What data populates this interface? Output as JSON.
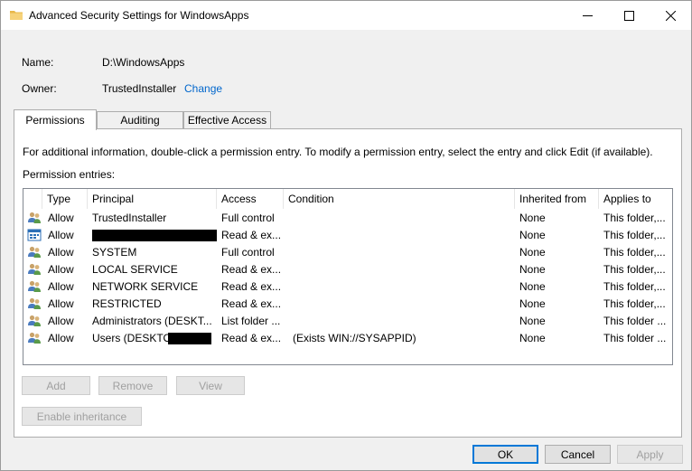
{
  "window": {
    "title": "Advanced Security Settings for WindowsApps"
  },
  "info": {
    "name_label": "Name:",
    "name_value": "D:\\WindowsApps",
    "owner_label": "Owner:",
    "owner_value": "TrustedInstaller",
    "change_link": "Change"
  },
  "tabs": [
    {
      "label": "Permissions",
      "active": true
    },
    {
      "label": "Auditing",
      "active": false
    },
    {
      "label": "Effective Access",
      "active": false
    }
  ],
  "panel": {
    "instructions": "For additional information, double-click a permission entry. To modify a permission entry, select the entry and click Edit (if available).",
    "entries_label": "Permission entries:"
  },
  "table": {
    "headers": [
      "Type",
      "Principal",
      "Access",
      "Condition",
      "Inherited from",
      "Applies to"
    ],
    "rows": [
      {
        "icon": "users-icon",
        "type": "Allow",
        "principal": "TrustedInstaller",
        "access": "Full control",
        "condition": "",
        "inherited": "None",
        "applies": "This folder,..."
      },
      {
        "icon": "app-package-icon",
        "type": "Allow",
        "principal": "",
        "access": "Read & ex...",
        "condition": "",
        "inherited": "None",
        "applies": "This folder,..."
      },
      {
        "icon": "users-icon",
        "type": "Allow",
        "principal": "SYSTEM",
        "access": "Full control",
        "condition": "",
        "inherited": "None",
        "applies": "This folder,..."
      },
      {
        "icon": "users-icon",
        "type": "Allow",
        "principal": "LOCAL SERVICE",
        "access": "Read & ex...",
        "condition": "",
        "inherited": "None",
        "applies": "This folder,..."
      },
      {
        "icon": "users-icon",
        "type": "Allow",
        "principal": "NETWORK SERVICE",
        "access": "Read & ex...",
        "condition": "",
        "inherited": "None",
        "applies": "This folder,..."
      },
      {
        "icon": "users-icon",
        "type": "Allow",
        "principal": "RESTRICTED",
        "access": "Read & ex...",
        "condition": "",
        "inherited": "None",
        "applies": "This folder,..."
      },
      {
        "icon": "users-icon",
        "type": "Allow",
        "principal": "Administrators (DESKT...",
        "access": "List folder ...",
        "condition": "",
        "inherited": "None",
        "applies": "This folder ..."
      },
      {
        "icon": "users-icon",
        "type": "Allow",
        "principal": "Users (DESKTOP",
        "access": "Read & ex...",
        "condition": "(Exists WIN://SYSAPPID)",
        "inherited": "None",
        "applies": "This folder ..."
      }
    ]
  },
  "buttons": {
    "add": "Add",
    "remove": "Remove",
    "view": "View",
    "enable_inheritance": "Enable inheritance",
    "ok": "OK",
    "cancel": "Cancel",
    "apply": "Apply"
  },
  "colors": {
    "link": "#0066cc",
    "folder": "#e8b84a",
    "focus": "#0078d7"
  }
}
